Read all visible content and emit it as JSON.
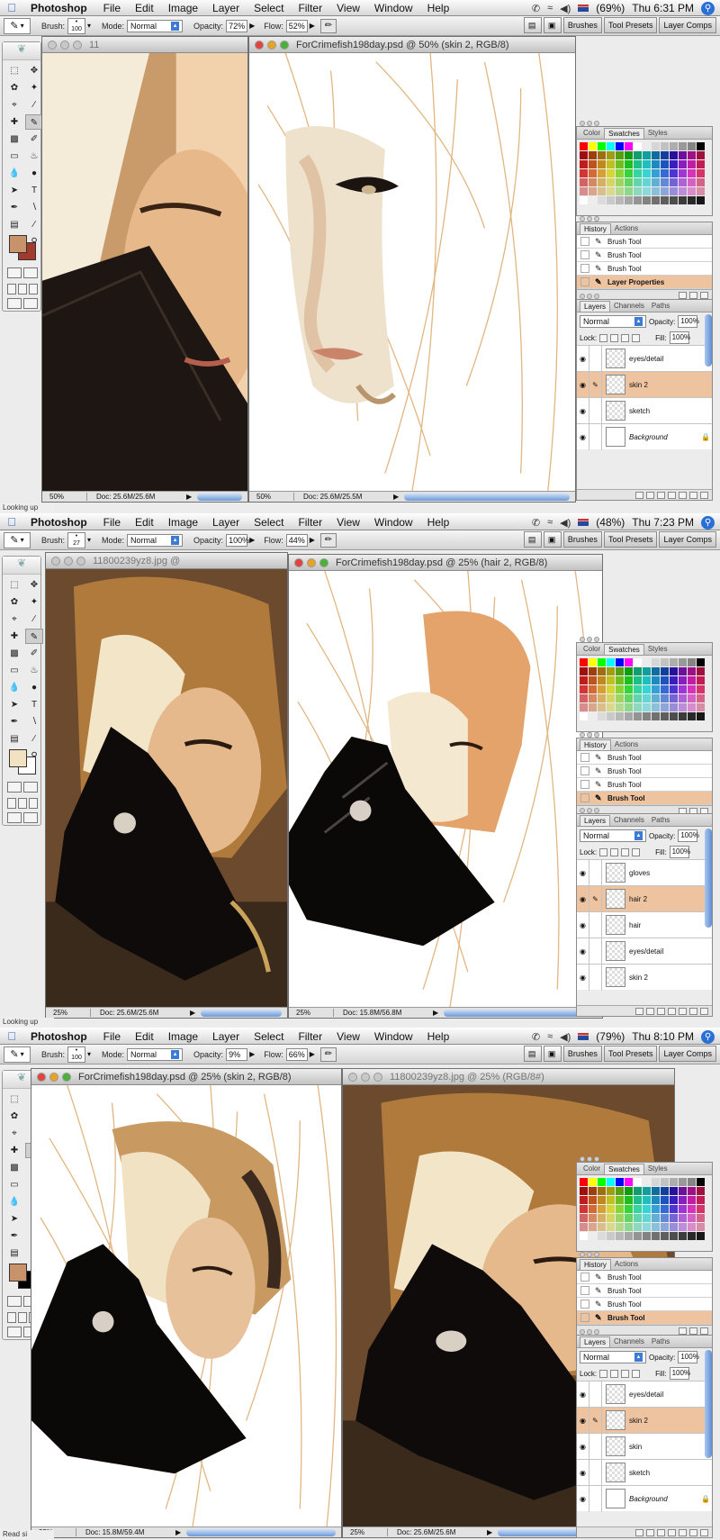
{
  "menubar": {
    "app_name": "Photoshop",
    "items": [
      "File",
      "Edit",
      "Image",
      "Layer",
      "Select",
      "Filter",
      "View",
      "Window",
      "Help"
    ]
  },
  "options": {
    "brush_label": "Brush:",
    "mode_label": "Mode:",
    "mode_value": "Normal",
    "opacity_label": "Opacity:",
    "flow_label": "Flow:",
    "palette_buttons": [
      "Brushes",
      "Tool Presets",
      "Layer Comps"
    ]
  },
  "panels": {
    "swatch_tabs": [
      "Color",
      "Swatches",
      "Styles"
    ],
    "history_tabs": [
      "History",
      "Actions"
    ],
    "layers_tabs": [
      "Layers",
      "Channels",
      "Paths"
    ],
    "blend_mode": "Normal",
    "opacity_label": "Opacity:",
    "opacity_value": "100%",
    "lock_label": "Lock:",
    "fill_label": "Fill:",
    "fill_value": "100%"
  },
  "swatch_colors": [
    "#ff0000",
    "#ffff00",
    "#00ff00",
    "#00ffff",
    "#0000ff",
    "#ff00ff",
    "#ffffff",
    "#ebebeb",
    "#d6d6d6",
    "#c2c2c2",
    "#adadad",
    "#999999",
    "#858585",
    "#000000"
  ],
  "frames": [
    {
      "battery": "(69%)",
      "clock": "Thu 6:31 PM",
      "brush_size": "100",
      "opacity": "72%",
      "flow": "52%",
      "palette_buttons": [
        "Brushes",
        "Tool Presets",
        "Layer Comps"
      ],
      "status_text": "Looking up",
      "ref_window": {
        "title": "11",
        "zoom": "50%",
        "doc": "Doc: 25.6M/25.6M"
      },
      "main_window": {
        "title": "ForCrimefish198day.psd @ 50% (skin 2, RGB/8)",
        "zoom": "50%",
        "doc": "Doc: 25.6M/25.5M"
      },
      "history": [
        {
          "label": "Brush Tool",
          "selected": false
        },
        {
          "label": "Brush Tool",
          "selected": false
        },
        {
          "label": "Brush Tool",
          "selected": false
        },
        {
          "label": "Layer Properties",
          "selected": true
        }
      ],
      "layers": [
        {
          "name": "eyes/detail",
          "selected": false,
          "italic": false
        },
        {
          "name": "skin 2",
          "selected": true,
          "italic": false
        },
        {
          "name": "sketch",
          "selected": false,
          "italic": false
        },
        {
          "name": "Background",
          "selected": false,
          "italic": true
        }
      ]
    },
    {
      "battery": "(48%)",
      "clock": "Thu 7:23 PM",
      "brush_size": "27",
      "opacity": "100%",
      "flow": "44%",
      "palette_buttons": [
        "Brushes",
        "Tool Presets",
        "Layer Comps"
      ],
      "status_text": "Looking up",
      "ref_window": {
        "title": "11800239yz8.jpg @",
        "zoom": "25%",
        "doc": "Doc: 25.6M/25.6M"
      },
      "main_window": {
        "title": "ForCrimefish198day.psd @ 25% (hair 2, RGB/8)",
        "zoom": "25%",
        "doc": "Doc: 15.8M/56.8M"
      },
      "history": [
        {
          "label": "Brush Tool",
          "selected": false
        },
        {
          "label": "Brush Tool",
          "selected": false
        },
        {
          "label": "Brush Tool",
          "selected": false
        },
        {
          "label": "Brush Tool",
          "selected": true
        }
      ],
      "layers": [
        {
          "name": "gloves",
          "selected": false,
          "italic": false
        },
        {
          "name": "hair 2",
          "selected": true,
          "italic": false
        },
        {
          "name": "hair",
          "selected": false,
          "italic": false
        },
        {
          "name": "eyes/detail",
          "selected": false,
          "italic": false
        },
        {
          "name": "skin 2",
          "selected": false,
          "italic": false
        }
      ]
    },
    {
      "battery": "(79%)",
      "clock": "Thu 8:10 PM",
      "brush_size": "100",
      "opacity": "9%",
      "flow": "66%",
      "palette_buttons": [
        "Brushes",
        "Tool Presets",
        "Layer Comps"
      ],
      "status_text": "Read si",
      "ref_window": {
        "title": "11800239yz8.jpg @ 25% (RGB/8#)",
        "zoom": "25%",
        "doc": "Doc: 25.6M/25.6M"
      },
      "main_window": {
        "title": "ForCrimefish198day.psd @ 25% (skin 2, RGB/8)",
        "zoom": "25%",
        "doc": "Doc: 15.8M/59.4M"
      },
      "history": [
        {
          "label": "Brush Tool",
          "selected": false
        },
        {
          "label": "Brush Tool",
          "selected": false
        },
        {
          "label": "Brush Tool",
          "selected": false
        },
        {
          "label": "Brush Tool",
          "selected": true
        }
      ],
      "layers": [
        {
          "name": "eyes/detail",
          "selected": false,
          "italic": false
        },
        {
          "name": "skin 2",
          "selected": true,
          "italic": false
        },
        {
          "name": "skin",
          "selected": false,
          "italic": false
        },
        {
          "name": "sketch",
          "selected": false,
          "italic": false
        },
        {
          "name": "Background",
          "selected": false,
          "italic": true
        }
      ]
    }
  ]
}
